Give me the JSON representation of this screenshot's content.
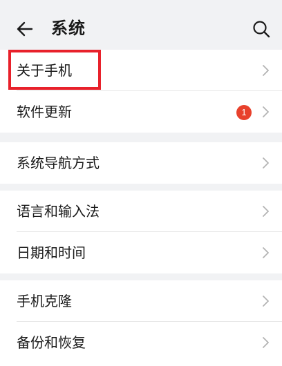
{
  "header": {
    "title": "系统",
    "back_icon": "arrow-left-icon",
    "search_icon": "search-icon"
  },
  "groups": [
    {
      "items": [
        {
          "label": "关于手机"
        },
        {
          "label": "软件更新",
          "badge": "1"
        }
      ]
    },
    {
      "items": [
        {
          "label": "系统导航方式"
        }
      ]
    },
    {
      "items": [
        {
          "label": "语言和输入法"
        },
        {
          "label": "日期和时间"
        }
      ]
    },
    {
      "items": [
        {
          "label": "手机克隆"
        },
        {
          "label": "备份和恢复"
        }
      ]
    }
  ],
  "colors": {
    "background": "#f1f2f4",
    "badge": "#e8412c",
    "highlight": "#e8212b"
  }
}
